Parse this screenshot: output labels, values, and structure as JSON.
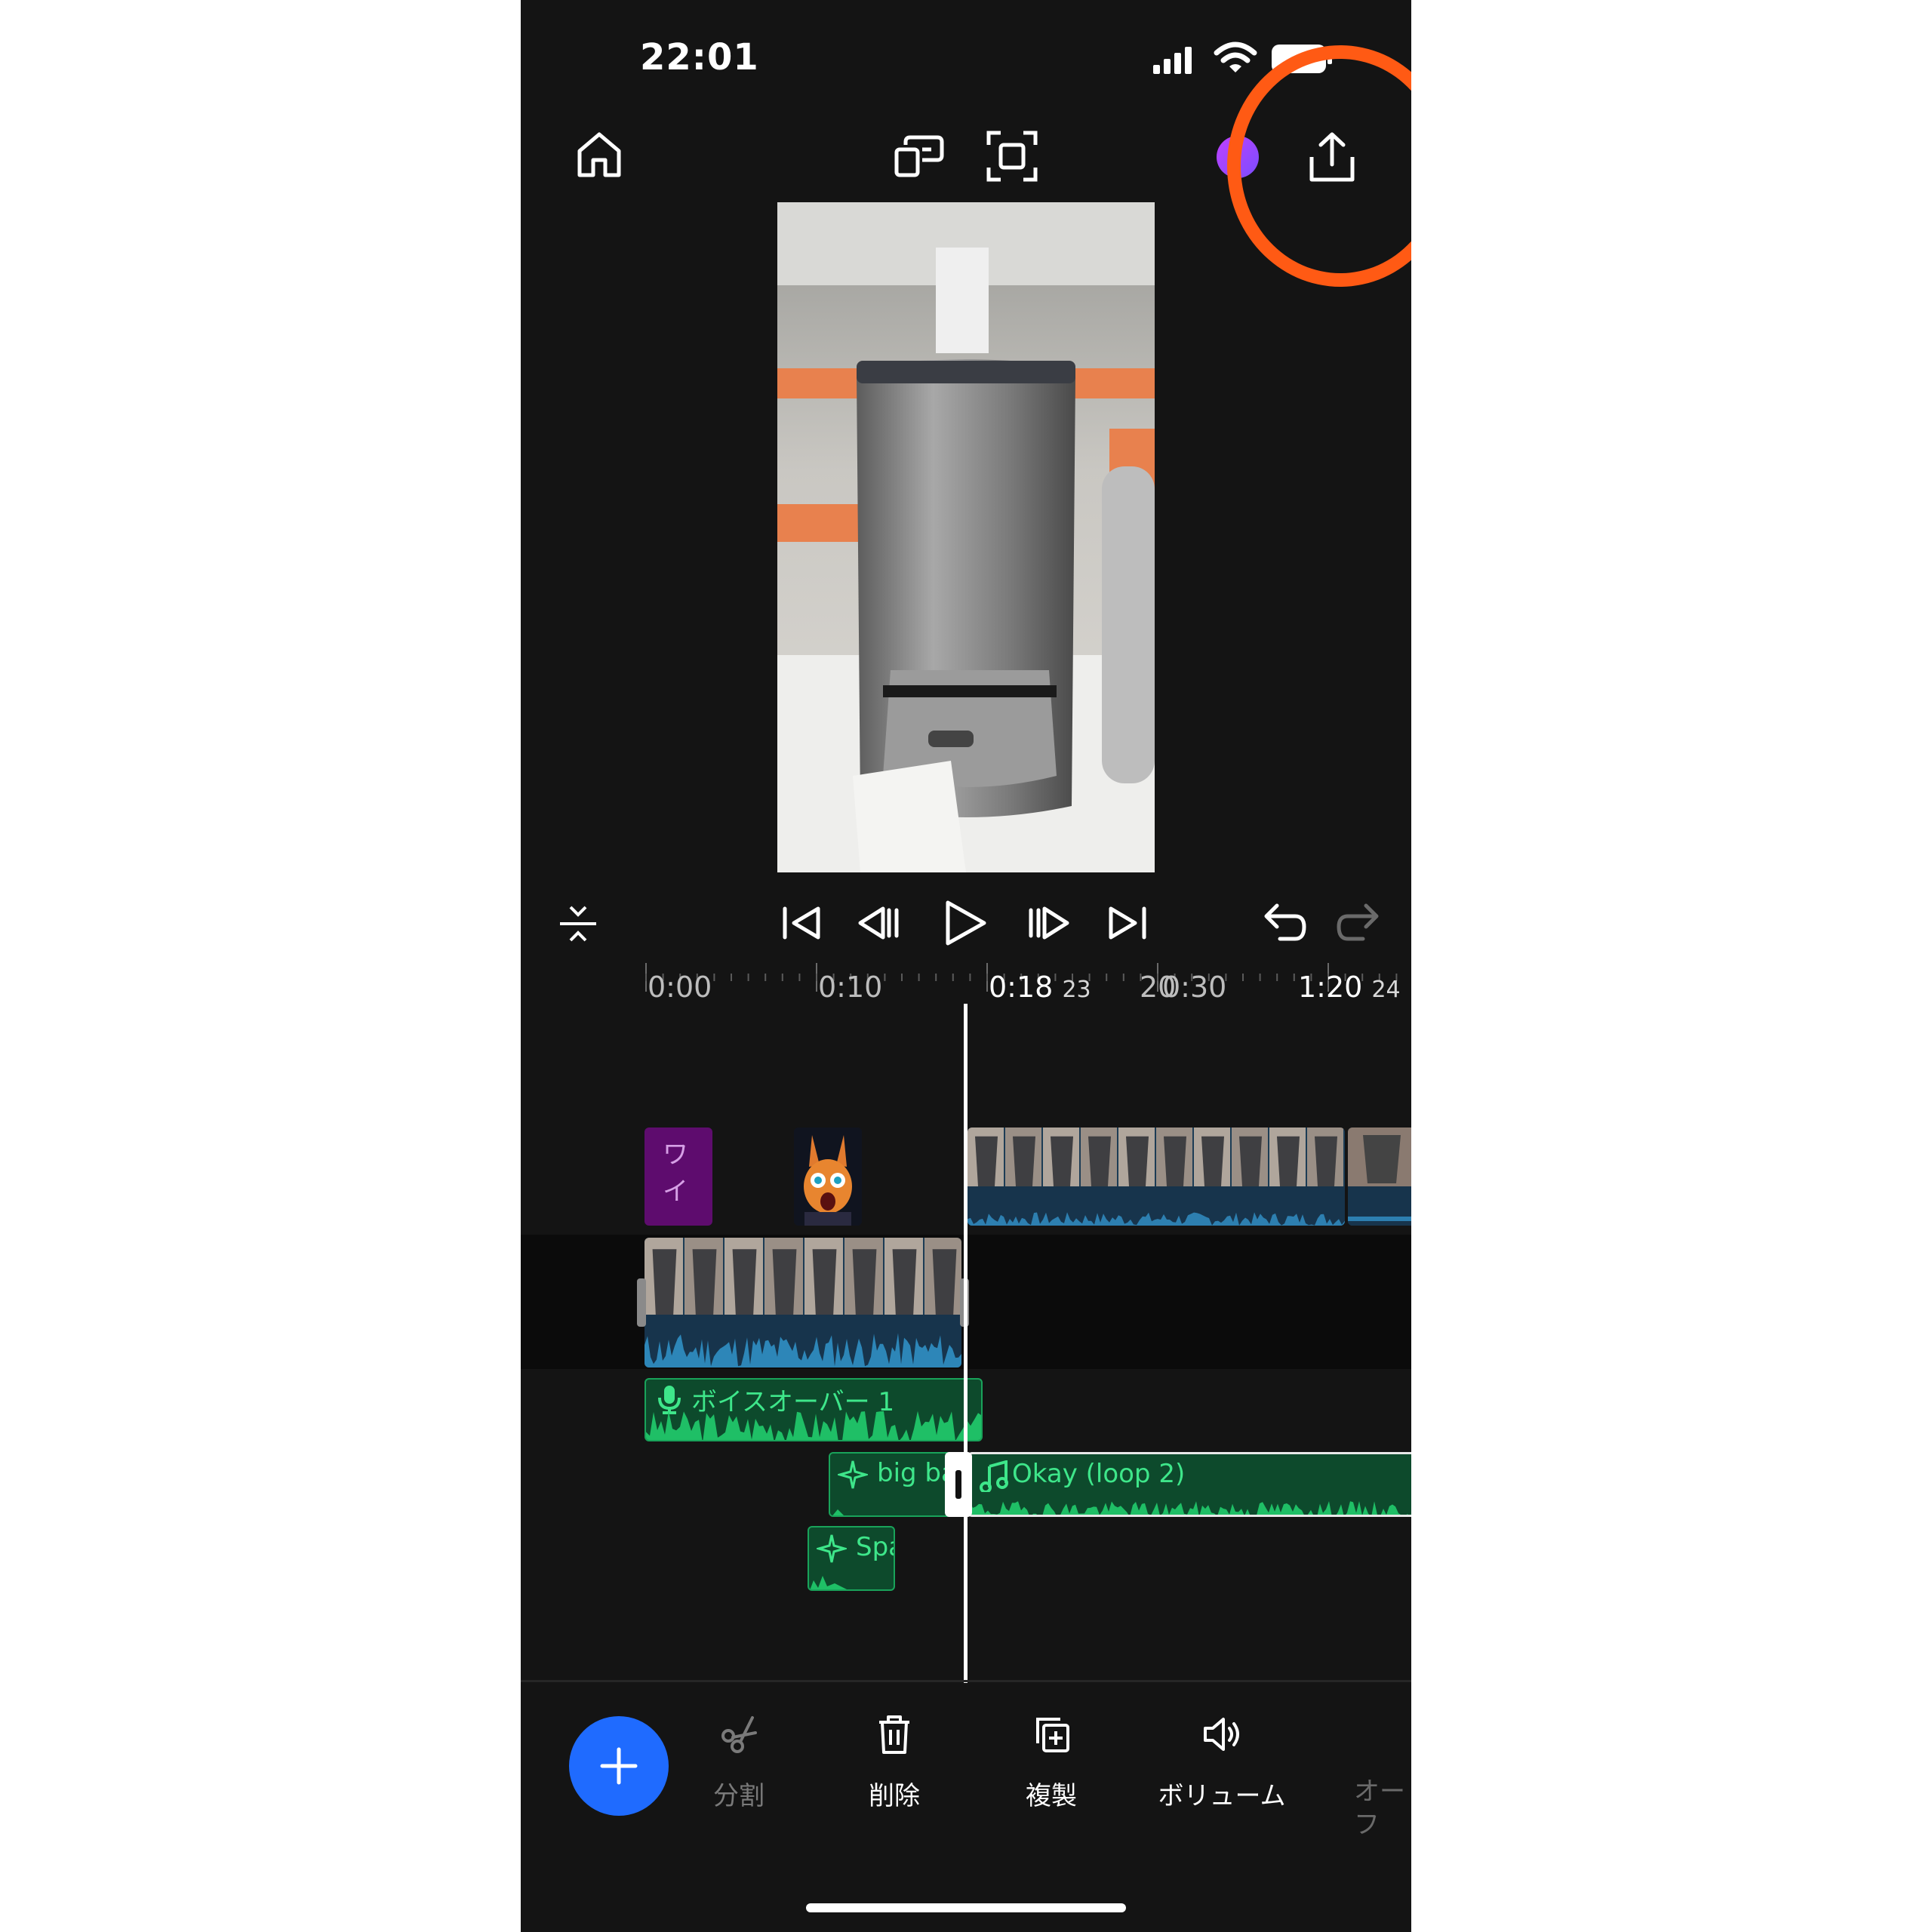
{
  "status_bar": {
    "time": "22:01"
  },
  "timeline": {
    "ruler": {
      "t0": "0:00",
      "t1": "0:10",
      "playhead_time": "0:18",
      "playhead_frames": "23",
      "t3": "20",
      "t4": "0:30",
      "total_time": "1:20",
      "total_frames": "24"
    },
    "title_clip_text": "ワイ",
    "voiceover_label": "ボイスオーバー 1",
    "sfx1_label": "big ba",
    "music_label": "Okay (loop 2)",
    "sfx2_label": "Spa"
  },
  "toolbar": {
    "split": "分割",
    "delete": "削除",
    "duplicate": "複製",
    "volume": "ボリューム",
    "more": "オーフ"
  },
  "colors": {
    "background": "#141414",
    "accent_blue": "#1f6bff",
    "highlight_ring": "#ff5a14",
    "audio_green": "#19a35a",
    "title_purple": "#5e0c6e"
  }
}
